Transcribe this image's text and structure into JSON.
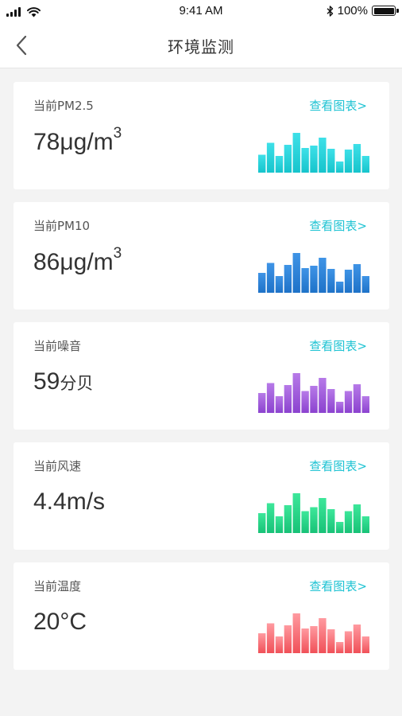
{
  "status": {
    "time": "9:41 AM",
    "battery": "100%"
  },
  "nav": {
    "title": "环境监测"
  },
  "cards": [
    {
      "label": "当前PM2.5",
      "value": "78",
      "unit": "μg/m",
      "sup": "3",
      "link": "查看图表>",
      "color_top": "#3ee0e8",
      "color_bottom": "#16c4cc",
      "bars": [
        0.45,
        0.75,
        0.42,
        0.7,
        1.0,
        0.62,
        0.68,
        0.88,
        0.6,
        0.28,
        0.58,
        0.72,
        0.42
      ]
    },
    {
      "label": "当前PM10",
      "value": "86",
      "unit": "μg/m",
      "sup": "3",
      "link": "查看图表>",
      "color_top": "#3f94e6",
      "color_bottom": "#1e72c8",
      "bars": [
        0.5,
        0.75,
        0.42,
        0.7,
        1.0,
        0.62,
        0.68,
        0.88,
        0.6,
        0.28,
        0.58,
        0.72,
        0.42
      ]
    },
    {
      "label": "当前噪音",
      "value": "59",
      "unit": "分贝",
      "sup": "",
      "link": "查看图表>",
      "color_top": "#b77ae8",
      "color_bottom": "#8b42cf",
      "bars": [
        0.5,
        0.75,
        0.42,
        0.7,
        1.0,
        0.55,
        0.68,
        0.88,
        0.6,
        0.28,
        0.55,
        0.72,
        0.42
      ]
    },
    {
      "label": "当前风速",
      "value": "4.4",
      "unit": "m/s",
      "sup": "",
      "link": "查看图表>",
      "color_top": "#3de79a",
      "color_bottom": "#18c277",
      "bars": [
        0.5,
        0.75,
        0.42,
        0.7,
        1.0,
        0.55,
        0.65,
        0.88,
        0.6,
        0.28,
        0.55,
        0.72,
        0.42
      ]
    },
    {
      "label": "当前温度",
      "value": "20",
      "unit": "°C",
      "sup": "",
      "link": "查看图表>",
      "color_top": "#ff9aa0",
      "color_bottom": "#f05058",
      "bars": [
        0.5,
        0.75,
        0.42,
        0.7,
        1.0,
        0.62,
        0.68,
        0.88,
        0.6,
        0.28,
        0.55,
        0.72,
        0.42
      ]
    }
  ]
}
